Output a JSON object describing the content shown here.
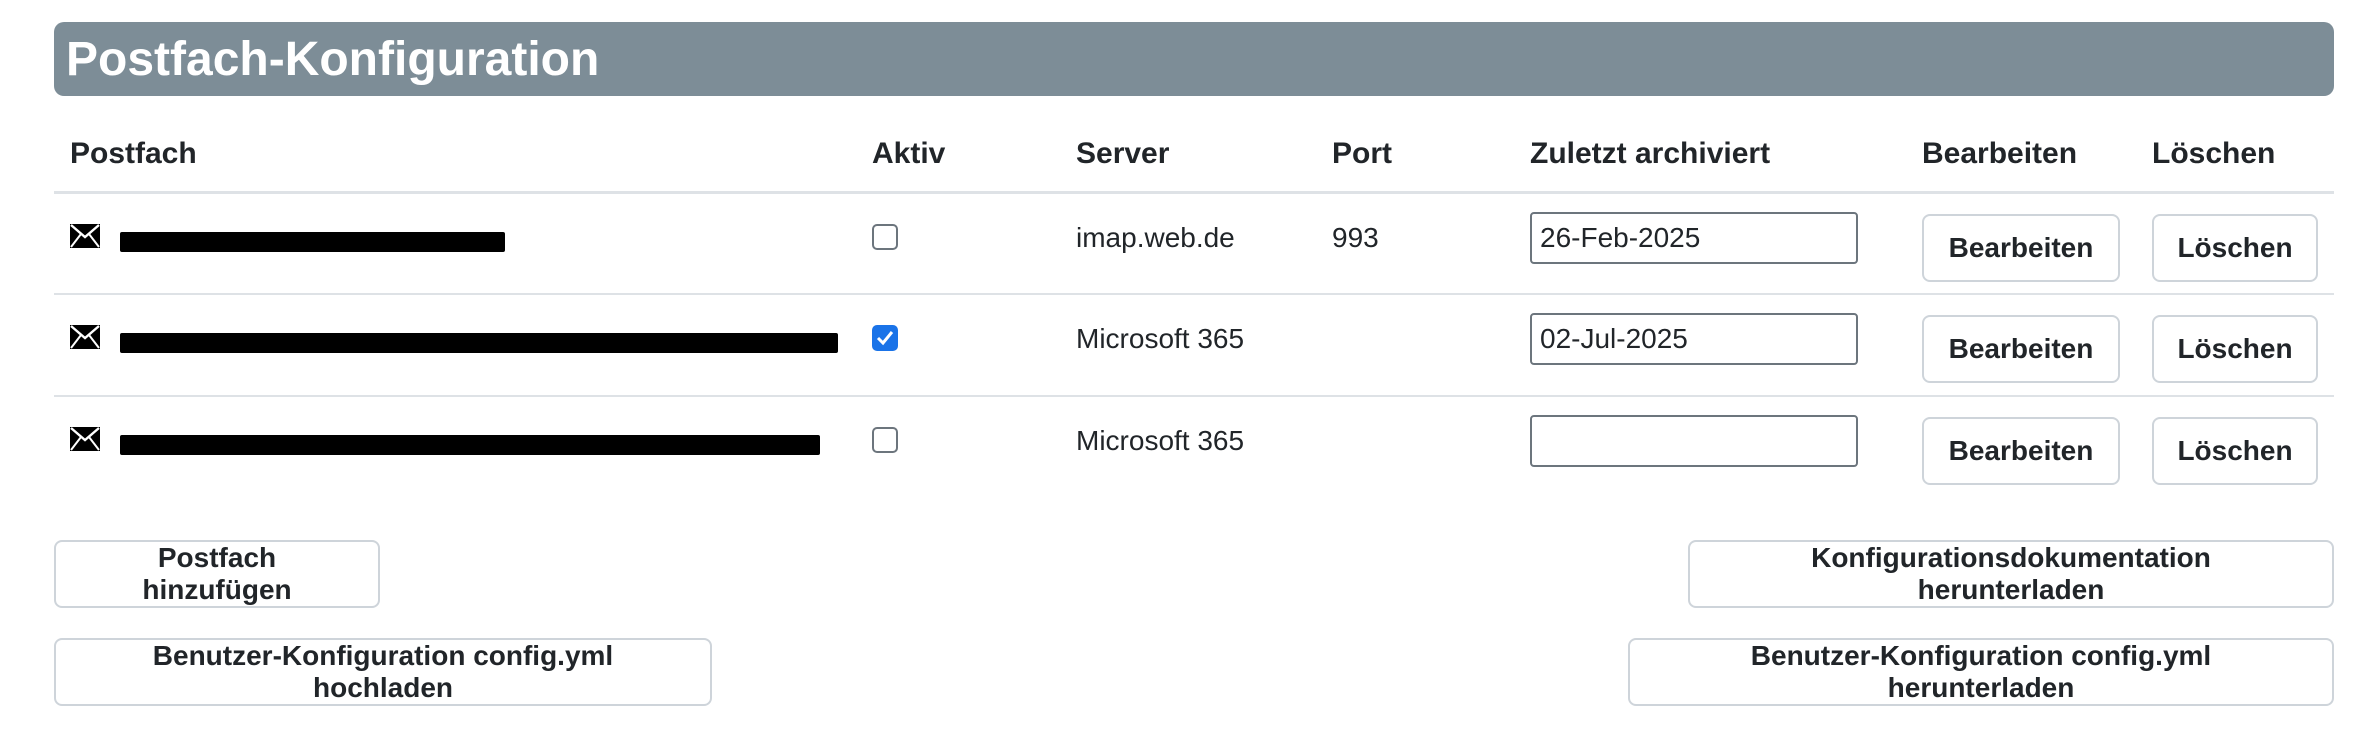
{
  "header": {
    "title": "Postfach-Konfiguration"
  },
  "table": {
    "columns": {
      "postfach": "Postfach",
      "aktiv": "Aktiv",
      "server": "Server",
      "port": "Port",
      "zuletzt": "Zuletzt archiviert",
      "bearbeiten": "Bearbeiten",
      "loeschen": "Löschen"
    },
    "rows": [
      {
        "active": false,
        "server": "imap.web.de",
        "port": "993",
        "last_archived": "26-Feb-2025",
        "edit_label": "Bearbeiten",
        "delete_label": "Löschen"
      },
      {
        "active": true,
        "server": "Microsoft 365",
        "port": "",
        "last_archived": "02-Jul-2025",
        "edit_label": "Bearbeiten",
        "delete_label": "Löschen"
      },
      {
        "active": false,
        "server": "Microsoft 365",
        "port": "",
        "last_archived": "",
        "edit_label": "Bearbeiten",
        "delete_label": "Löschen"
      }
    ]
  },
  "actions": {
    "add_mailbox": "Postfach hinzufügen",
    "upload_config": "Benutzer-Konfiguration config.yml hochladen",
    "download_docs": "Konfigurationsdokumentation herunterladen",
    "download_config": "Benutzer-Konfiguration config.yml herunterladen"
  },
  "colors": {
    "header_bg": "#7d8d97",
    "checkbox_checked": "#1a73e8"
  },
  "icons": {
    "mailbox": "envelope-icon"
  }
}
